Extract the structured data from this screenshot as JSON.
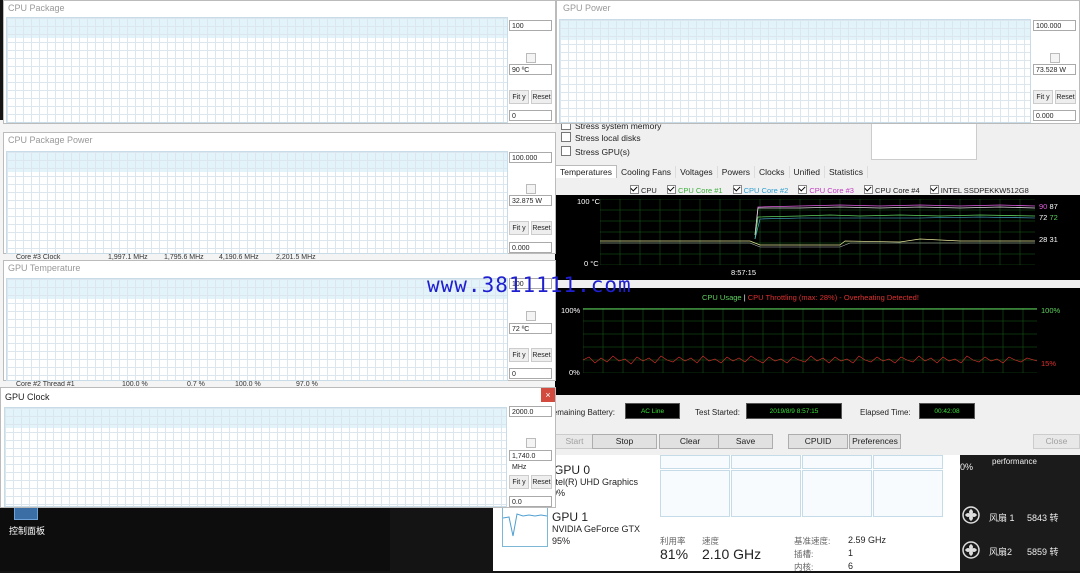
{
  "watermark": "www.3811111.com",
  "graph_windows": [
    {
      "title": "CPU Package",
      "field_top": "100",
      "field_mid": "90 ºC",
      "fit_label": "Fit y",
      "reset_label": "Reset",
      "field_bottom": "0"
    },
    {
      "title": "CPU Package Power",
      "field_top": "100.000",
      "field_mid": "32.875 W",
      "fit_label": "Fit y",
      "reset_label": "Reset",
      "field_bottom": "0.000"
    },
    {
      "title": "GPU Temperature",
      "field_top": "100",
      "field_mid": "72 ºC",
      "fit_label": "Fit y",
      "reset_label": "Reset",
      "field_bottom": "0"
    },
    {
      "title": "GPU Clock",
      "field_top": "2000.0",
      "field_mid": "1,740.0 MHz",
      "fit_label": "Fit y",
      "reset_label": "Reset",
      "field_bottom": "0.0",
      "close_label": "×"
    },
    {
      "title": "GPU Power",
      "field_top": "100.000",
      "field_mid": "73.528 W",
      "fit_label": "Fit y",
      "reset_label": "Reset",
      "field_bottom": "0.000"
    }
  ],
  "behind_rows": [
    {
      "label": "Core #3 Clock",
      "v1": "1,997.1 MHz",
      "v2": "1,795.6 MHz",
      "v3": "4,190.6 MHz",
      "v4": "2,201.5 MHz"
    },
    {
      "label": "Core #2 Thread #1",
      "v1": "100.0 %",
      "v2": "0.7 %",
      "v3": "100.0 %",
      "v4": "97.0 %"
    }
  ],
  "stability": {
    "stress_options": [
      "Stress system memory",
      "Stress local disks",
      "Stress GPU(s)"
    ],
    "tabs": [
      "Temperatures",
      "Cooling Fans",
      "Voltages",
      "Powers",
      "Clocks",
      "Unified",
      "Statistics"
    ],
    "legend": [
      {
        "label": "CPU",
        "color": "#ffffff"
      },
      {
        "label": "CPU Core #1",
        "color": "#5fd35f"
      },
      {
        "label": "CPU Core #2",
        "color": "#4fc3e8"
      },
      {
        "label": "CPU Core #3",
        "color": "#e05ce0"
      },
      {
        "label": "CPU Core #4",
        "color": "#ffffff"
      },
      {
        "label": "INTEL SSDPEKKW512G8",
        "color": "#e8e89a"
      }
    ],
    "temp_chart": {
      "ytop": "100 °C",
      "ybottom": "0 °C",
      "time": "8:57:15",
      "right_labels": [
        {
          "text": "90",
          "color": "#e05ce0"
        },
        {
          "text": "87",
          "color": "#ffffff"
        },
        {
          "text": "72",
          "color": "#ffffff"
        },
        {
          "text": "72",
          "color": "#5fd35f"
        },
        {
          "text": "28",
          "color": "#ffffff"
        },
        {
          "text": "31",
          "color": "#ffffff"
        }
      ]
    },
    "usage_chart": {
      "title_a": "CPU Usage",
      "title_sep": "|",
      "title_b": "CPU Throttling (max: 28%) - Overheating Detected!",
      "left_top": "100%",
      "left_bottom": "0%",
      "right_top": "100%",
      "right_bottom": "15%"
    },
    "info": {
      "battery_label": "Remaining Battery:",
      "battery_value": "AC Line",
      "started_label": "Test Started:",
      "started_value": "2019/8/9 8:57:15",
      "elapsed_label": "Elapsed Time:",
      "elapsed_value": "00:42:08"
    },
    "buttons": {
      "start": "Start",
      "stop": "Stop",
      "clear": "Clear",
      "save": "Save",
      "cpuid": "CPUID",
      "preferences": "Preferences",
      "close": "Close"
    }
  },
  "taskmgr": {
    "gpu0_name": "GPU 0",
    "gpu0_desc": "Intel(R) UHD Graphics",
    "gpu0_pct": "0%",
    "gpu1_name": "GPU 1",
    "gpu1_desc": "NVIDIA GeForce GTX",
    "gpu1_pct": "95%",
    "util_label": "利用率",
    "util_value": "81%",
    "speed_label": "速度",
    "speed_value": "2.10 GHz",
    "base_speed_label": "基准速度:",
    "base_speed_value": "2.59 GHz",
    "socket_label": "插槽:",
    "socket_value": "1",
    "cores_label": "内核:",
    "cores_value": "6"
  },
  "desktop": {
    "partial_pct": "0%",
    "performance_label": "performance",
    "fan1_label": "风扇 1",
    "fan1_value": "5843 转",
    "fan2_label": "风扇2",
    "fan2_value": "5859 转",
    "control_panel_label": "控制面板"
  }
}
